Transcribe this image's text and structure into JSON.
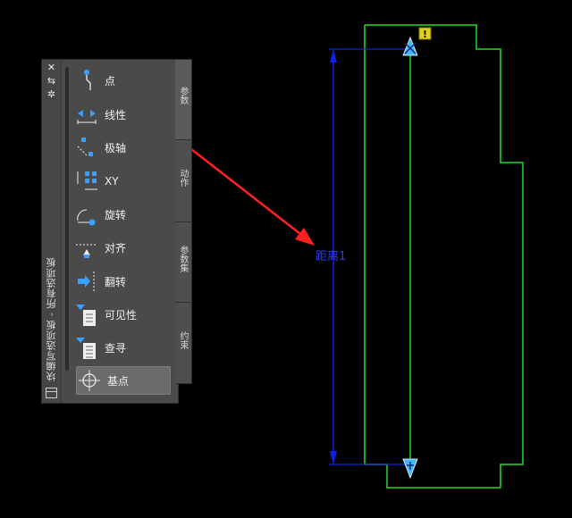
{
  "palette": {
    "title": "块编写选项板 - 所有选项板",
    "tools": [
      {
        "label": "点",
        "icon": "point-param-icon"
      },
      {
        "label": "线性",
        "icon": "linear-param-icon"
      },
      {
        "label": "极轴",
        "icon": "polar-param-icon"
      },
      {
        "label": "XY",
        "icon": "xy-param-icon"
      },
      {
        "label": "旋转",
        "icon": "rotation-param-icon"
      },
      {
        "label": "对齐",
        "icon": "alignment-param-icon"
      },
      {
        "label": "翻转",
        "icon": "flip-param-icon"
      },
      {
        "label": "可见性",
        "icon": "visibility-param-icon"
      },
      {
        "label": "查寻",
        "icon": "lookup-param-icon"
      },
      {
        "label": "基点",
        "icon": "basepoint-param-icon"
      }
    ],
    "selected_tool": "基点",
    "highlighted_tool": "线性"
  },
  "tabs": [
    {
      "label": "参数",
      "active": true
    },
    {
      "label": "动作",
      "active": false
    },
    {
      "label": "参数集",
      "active": false
    },
    {
      "label": "约束",
      "active": false
    }
  ],
  "drawing": {
    "dimension_label": "距离1",
    "warning_badge": "!"
  },
  "colors": {
    "geometry": "#22dd22",
    "dimension": "#1020e0",
    "callout": "#ff2020",
    "grip": "#40b8ff"
  }
}
